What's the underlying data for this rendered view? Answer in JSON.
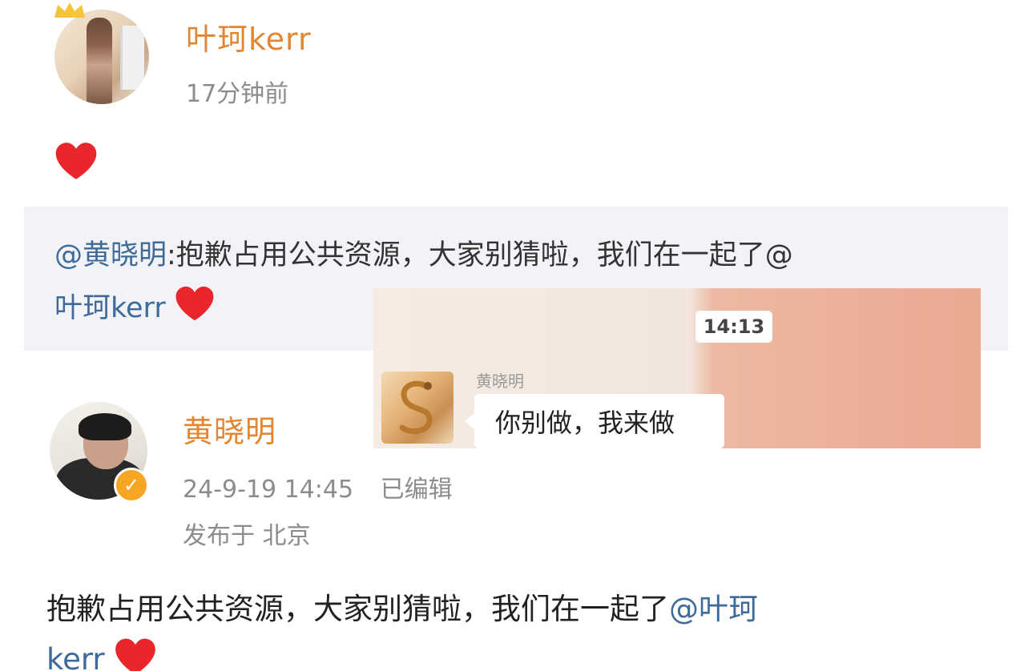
{
  "post1": {
    "username": "叶珂kerr",
    "time": "17分钟前"
  },
  "repost": {
    "mention": "@黄晓明",
    "text_line1": ":抱歉占用公共资源，大家别猜啦，我们在一起了@",
    "line2_mention": "叶珂kerr"
  },
  "chat_image": {
    "time": "14:13",
    "sender": "黄晓明",
    "message": "你别做，我来做"
  },
  "post2": {
    "username": "黄晓明",
    "date": "24-9-19 14:45",
    "edited": "已编辑",
    "location": "发布于 北京",
    "content_line1": "抱歉占用公共资源，大家别猜啦，我们在一起了",
    "content_mention_a": "@叶珂",
    "content_mention_b": "kerr"
  },
  "colors": {
    "username": "#e38531",
    "mention": "#3f6a9a",
    "heart": "#e8262b",
    "badge": "#f6a623"
  }
}
